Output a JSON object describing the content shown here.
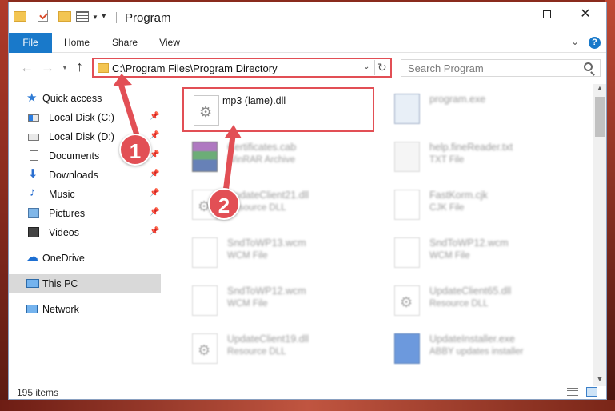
{
  "window": {
    "title": "Program"
  },
  "ribbon": {
    "tabs": [
      "File",
      "Home",
      "Share",
      "View"
    ],
    "help_label": "?"
  },
  "nav": {
    "address_path": "C:\\Program Files\\Program Directory",
    "search_placeholder": "Search Program"
  },
  "sidebar": {
    "items": [
      {
        "label": "Quick access",
        "icon": "star-icon",
        "pinned": false
      },
      {
        "label": "Local Disk (C:)",
        "icon": "drive-icon",
        "pinned": true
      },
      {
        "label": "Local Disk (D:)",
        "icon": "drive-icon",
        "pinned": true
      },
      {
        "label": "Documents",
        "icon": "documents-icon",
        "pinned": true
      },
      {
        "label": "Downloads",
        "icon": "download-icon",
        "pinned": true
      },
      {
        "label": "Music",
        "icon": "music-icon",
        "pinned": true
      },
      {
        "label": "Pictures",
        "icon": "pictures-icon",
        "pinned": true
      },
      {
        "label": "Videos",
        "icon": "videos-icon",
        "pinned": true
      },
      {
        "label": "OneDrive",
        "icon": "onedrive-icon",
        "pinned": false
      },
      {
        "label": "This PC",
        "icon": "pc-icon",
        "pinned": false,
        "selected": true
      },
      {
        "label": "Network",
        "icon": "network-icon",
        "pinned": false
      }
    ]
  },
  "files": [
    {
      "name": "mp3 (lame).dll",
      "type": "",
      "icon": "dll-file-icon"
    },
    {
      "name": "program.exe",
      "type": "",
      "icon": "exe-file-icon"
    },
    {
      "name": "Certificates.cab",
      "type": "WinRAR Archive",
      "icon": "archive-file-icon"
    },
    {
      "name": "help.fineReader.txt",
      "type": "TXT File",
      "icon": "text-file-icon"
    },
    {
      "name": "UpdateClient21.dll",
      "type": "Resource DLL",
      "icon": "dll-file-icon"
    },
    {
      "name": "FastKorm.cjk",
      "type": "CJK File",
      "icon": "text-file-icon"
    },
    {
      "name": "SndToWP13.wcm",
      "type": "WCM File",
      "icon": "text-file-icon"
    },
    {
      "name": "SndToWP12.wcm",
      "type": "WCM File",
      "icon": "text-file-icon"
    },
    {
      "name": "SndToWP12.wcm",
      "type": "WCM File",
      "icon": "text-file-icon"
    },
    {
      "name": "UpdateClient65.dll",
      "type": "Resource DLL",
      "icon": "dll-file-icon"
    },
    {
      "name": "UpdateClient19.dll",
      "type": "Resource DLL",
      "icon": "dll-file-icon"
    },
    {
      "name": "UpdateInstaller.exe",
      "type": "ABBY updates installer",
      "icon": "installer-file-icon"
    }
  ],
  "status": {
    "item_count": "195 items"
  },
  "annotations": {
    "callout_1": "1",
    "callout_2": "2",
    "color": "#e24f55"
  }
}
